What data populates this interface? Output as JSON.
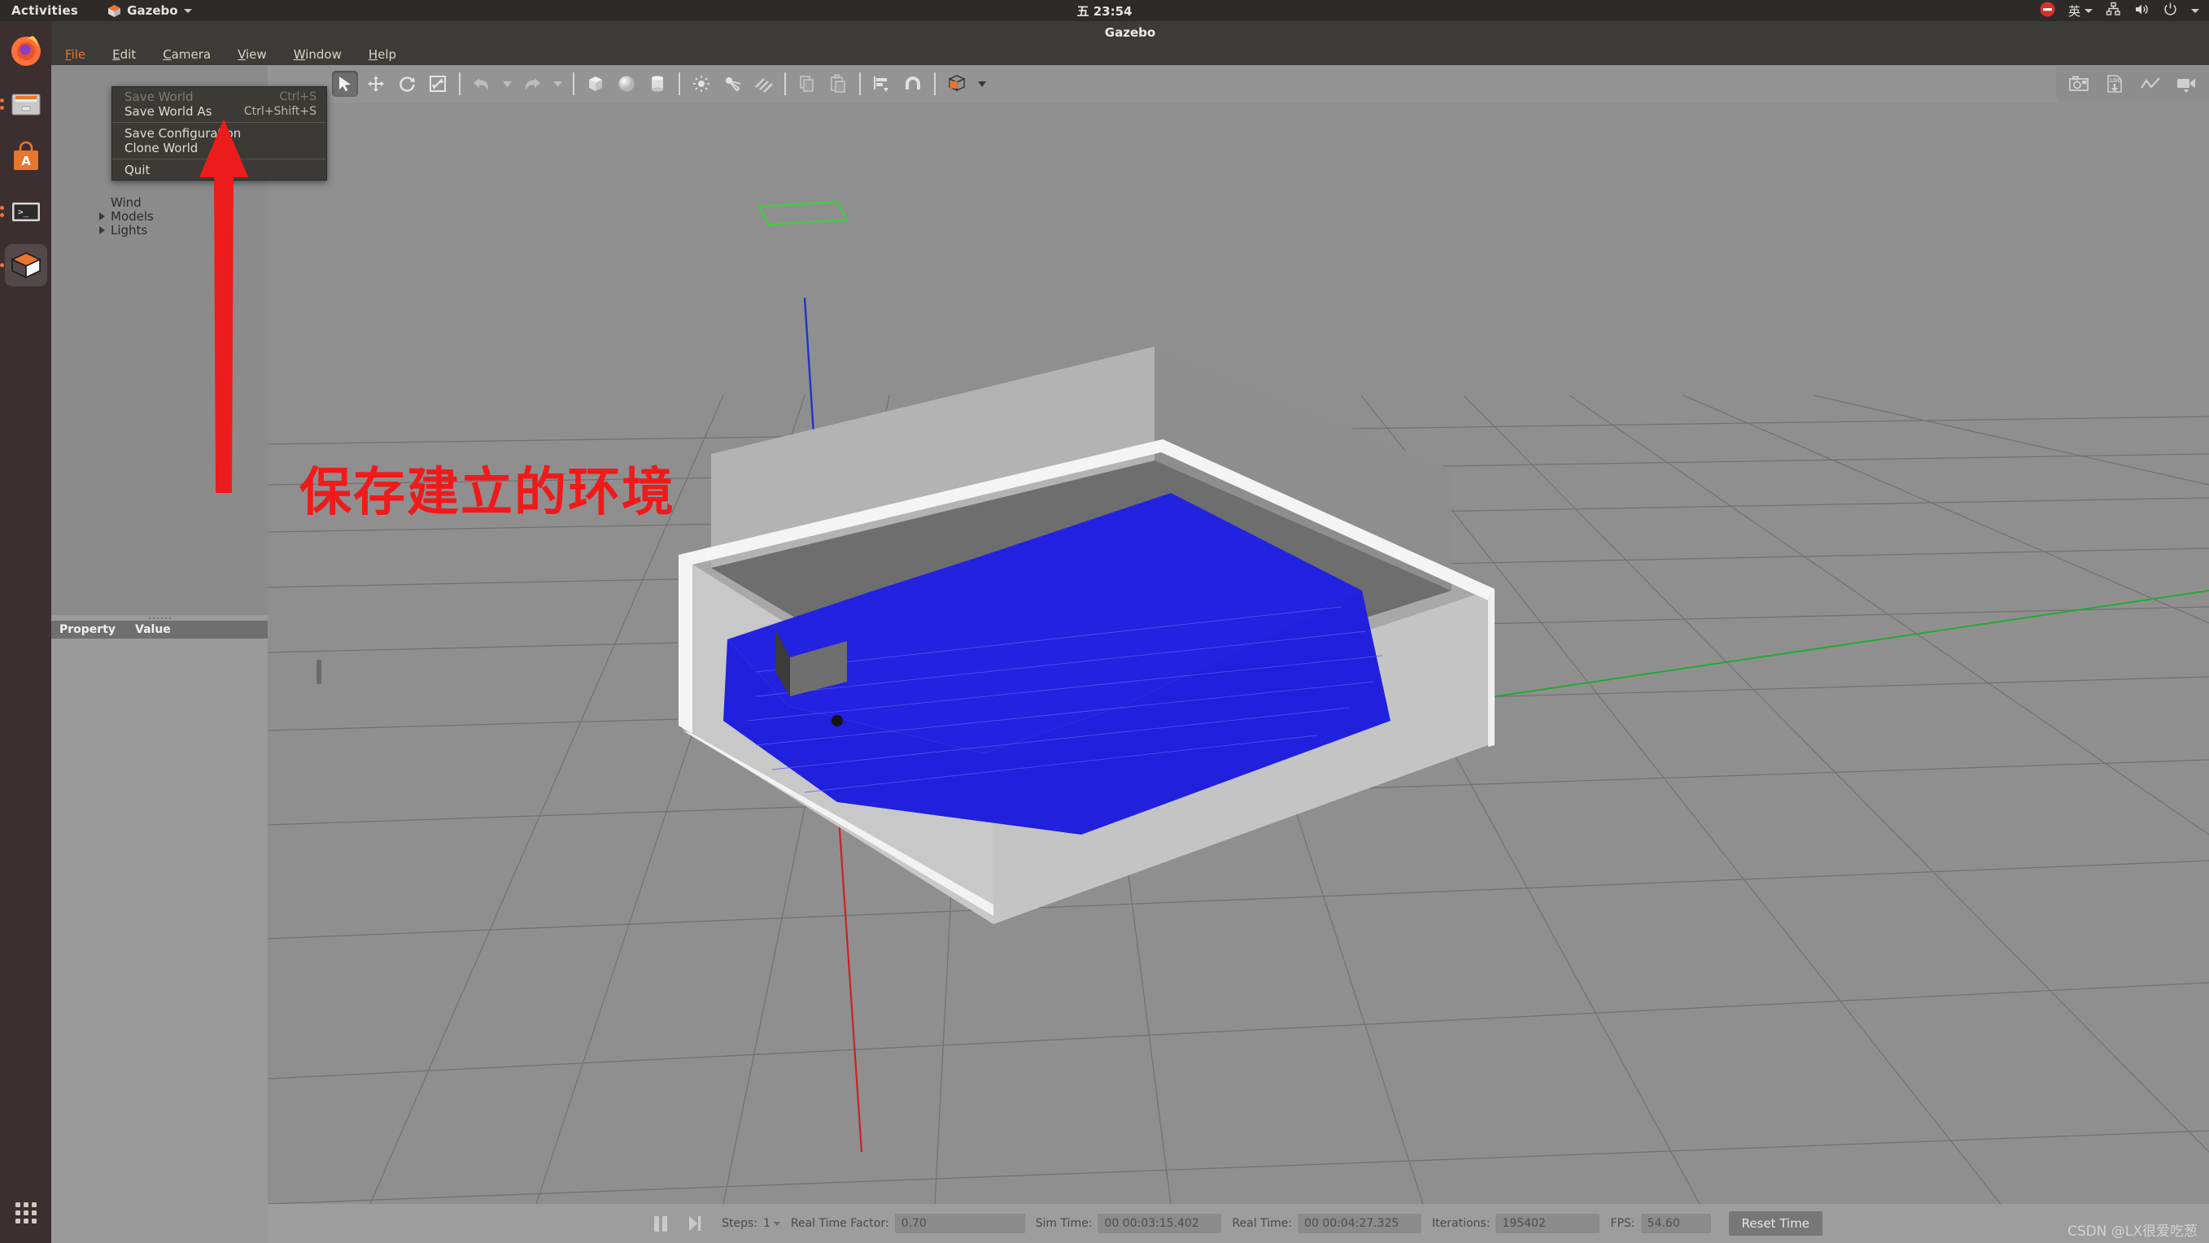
{
  "desktop": {
    "activities": "Activities",
    "app_name": "Gazebo",
    "clock": "五 23:54",
    "tray": {
      "dnd": "do-not-disturb",
      "input_method": "英",
      "network": "network-icon",
      "volume": "volume-icon",
      "power": "power-icon"
    },
    "dock": [
      {
        "name": "firefox",
        "label": "Firefox",
        "running": false,
        "active": false
      },
      {
        "name": "files",
        "label": "Files",
        "running": true,
        "active": false
      },
      {
        "name": "ubuntu-software",
        "label": "Ubuntu Software",
        "running": false,
        "active": false
      },
      {
        "name": "terminal",
        "label": "Terminal",
        "running": true,
        "active": false
      },
      {
        "name": "gazebo",
        "label": "Gazebo",
        "running": true,
        "active": true
      }
    ],
    "show_apps": "Show Applications"
  },
  "window": {
    "title": "Gazebo"
  },
  "menubar": {
    "items": [
      {
        "label": "File",
        "mnemonic": "F",
        "open": true
      },
      {
        "label": "Edit",
        "mnemonic": "E",
        "open": false
      },
      {
        "label": "Camera",
        "mnemonic": "C",
        "open": false
      },
      {
        "label": "View",
        "mnemonic": "V",
        "open": false
      },
      {
        "label": "Window",
        "mnemonic": "W",
        "open": false
      },
      {
        "label": "Help",
        "mnemonic": "H",
        "open": false
      }
    ]
  },
  "file_menu": {
    "items": [
      {
        "label": "Save World",
        "shortcut": "Ctrl+S",
        "disabled": true,
        "separator_after": false
      },
      {
        "label": "Save World As",
        "shortcut": "Ctrl+Shift+S",
        "disabled": false,
        "separator_after": true
      },
      {
        "label": "Save Configuration",
        "shortcut": "",
        "disabled": false,
        "separator_after": false
      },
      {
        "label": "Clone World",
        "shortcut": "",
        "disabled": false,
        "separator_after": true
      },
      {
        "label": "Quit",
        "shortcut": "",
        "disabled": false,
        "separator_after": false
      }
    ]
  },
  "left_panel": {
    "tree": [
      {
        "label": "Wind",
        "expandable": false,
        "expanded": false
      },
      {
        "label": "Models",
        "expandable": true,
        "expanded": false
      },
      {
        "label": "Lights",
        "expandable": true,
        "expanded": false
      }
    ],
    "property_table": {
      "columns": [
        "Property",
        "Value"
      ],
      "rows": []
    }
  },
  "toolbar": {
    "items": [
      {
        "name": "select-mode",
        "icon": "arrow-cursor-icon",
        "pressed": true
      },
      {
        "name": "translate-mode",
        "icon": "move-icon",
        "pressed": false
      },
      {
        "name": "rotate-mode",
        "icon": "rotate-icon",
        "pressed": false
      },
      {
        "name": "scale-mode",
        "icon": "scale-icon",
        "pressed": false
      },
      {
        "name": "separator-1",
        "icon": "separator",
        "pressed": false
      },
      {
        "name": "undo",
        "icon": "undo-icon",
        "pressed": false
      },
      {
        "name": "undo-history",
        "icon": "caret-down-icon",
        "pressed": false
      },
      {
        "name": "redo",
        "icon": "redo-icon",
        "pressed": false
      },
      {
        "name": "redo-history",
        "icon": "caret-down-icon",
        "pressed": false
      },
      {
        "name": "separator-2",
        "icon": "separator",
        "pressed": false
      },
      {
        "name": "insert-box",
        "icon": "box-icon",
        "pressed": false
      },
      {
        "name": "insert-sphere",
        "icon": "sphere-icon",
        "pressed": false
      },
      {
        "name": "insert-cylinder",
        "icon": "cylinder-icon",
        "pressed": false
      },
      {
        "name": "separator-3",
        "icon": "separator",
        "pressed": false
      },
      {
        "name": "point-light",
        "icon": "point-light-icon",
        "pressed": false
      },
      {
        "name": "spot-light",
        "icon": "spot-light-icon",
        "pressed": false
      },
      {
        "name": "directional-light",
        "icon": "directional-light-icon",
        "pressed": false
      },
      {
        "name": "separator-4",
        "icon": "separator",
        "pressed": false
      },
      {
        "name": "copy",
        "icon": "copy-icon",
        "pressed": false
      },
      {
        "name": "paste",
        "icon": "paste-icon",
        "pressed": false
      },
      {
        "name": "separator-5",
        "icon": "separator",
        "pressed": false
      },
      {
        "name": "align",
        "icon": "align-icon",
        "pressed": false
      },
      {
        "name": "snap",
        "icon": "magnet-icon",
        "pressed": false
      },
      {
        "name": "separator-6",
        "icon": "separator",
        "pressed": false
      },
      {
        "name": "view-angle",
        "icon": "view-cube-icon",
        "pressed": false
      }
    ],
    "right_items": [
      {
        "name": "screenshot",
        "icon": "camera-icon"
      },
      {
        "name": "log-record",
        "icon": "log-download-icon"
      },
      {
        "name": "plot",
        "icon": "plot-line-icon"
      },
      {
        "name": "video-record",
        "icon": "video-camera-icon"
      }
    ]
  },
  "viewport": {
    "grid": "ground-plane-grid",
    "axis_x_color": "#cc2222",
    "axis_y_color": "#22aa33",
    "axis_z_color": "#2233cc",
    "water_color": "#2222e0",
    "wall_color": "#f2f2f2",
    "floor_color": "#8f8f8f"
  },
  "annotation": {
    "text": "保存建立的环境",
    "color": "#f01a1a",
    "arrow_color": "#ec1c1c"
  },
  "statusbar": {
    "pause_button": "pause-icon",
    "step_button": "step-icon",
    "steps_label": "Steps:",
    "steps_value": "1",
    "rtf_label": "Real Time Factor:",
    "rtf_value": "0.70",
    "sim_time_label": "Sim Time:",
    "sim_time_value": "00 00:03:15.402",
    "real_time_label": "Real Time:",
    "real_time_value": "00 00:04:27.325",
    "iterations_label": "Iterations:",
    "iterations_value": "195402",
    "fps_label": "FPS:",
    "fps_value": "54.60",
    "reset_label": "Reset Time"
  },
  "watermark": {
    "text": "CSDN @LX很爱吃葱"
  }
}
